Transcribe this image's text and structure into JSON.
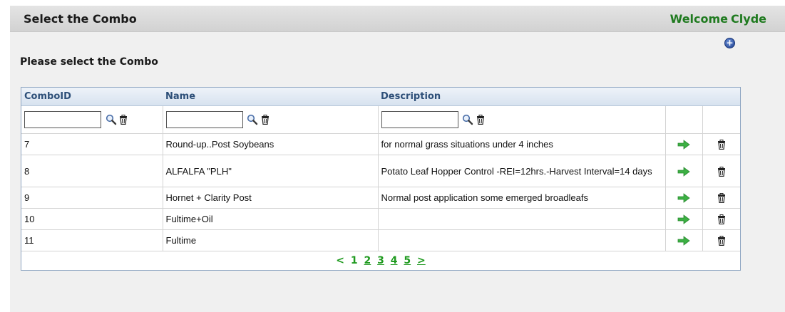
{
  "header": {
    "title": "Select the Combo",
    "welcome_prefix": "Welcome",
    "welcome_user": "Clyde"
  },
  "subtitle": "Please select the Combo",
  "add_icon": "plus-circle-icon",
  "table": {
    "columns": [
      "ComboID",
      "Name",
      "Description"
    ],
    "filters": [
      {
        "value": "",
        "placeholder": ""
      },
      {
        "value": "",
        "placeholder": ""
      },
      {
        "value": "",
        "placeholder": ""
      }
    ],
    "rows": [
      {
        "id": "7",
        "name": "Round-up..Post Soybeans",
        "description": "for normal grass situations under 4 inches"
      },
      {
        "id": "8",
        "name": "ALFALFA \"PLH\"",
        "description": "Potato Leaf Hopper Control -REI=12hrs.-Harvest Interval=14 days"
      },
      {
        "id": "9",
        "name": "Hornet + Clarity Post",
        "description": "Normal post application some emerged broadleafs"
      },
      {
        "id": "10",
        "name": "Fultime+Oil",
        "description": ""
      },
      {
        "id": "11",
        "name": "Fultime",
        "description": ""
      }
    ],
    "row_icons": {
      "select": "green-arrow-right-icon",
      "delete": "trash-can-icon",
      "search": "magnifier-icon"
    }
  },
  "pager": {
    "prev": "<",
    "current": "1",
    "pages": [
      "2",
      "3",
      "4",
      "5"
    ],
    "next": ">"
  },
  "colors": {
    "welcome": "#1f7a1f",
    "header_text": "#2d4f78",
    "pager": "#1f9a1f",
    "arrow": "#3cb043"
  }
}
